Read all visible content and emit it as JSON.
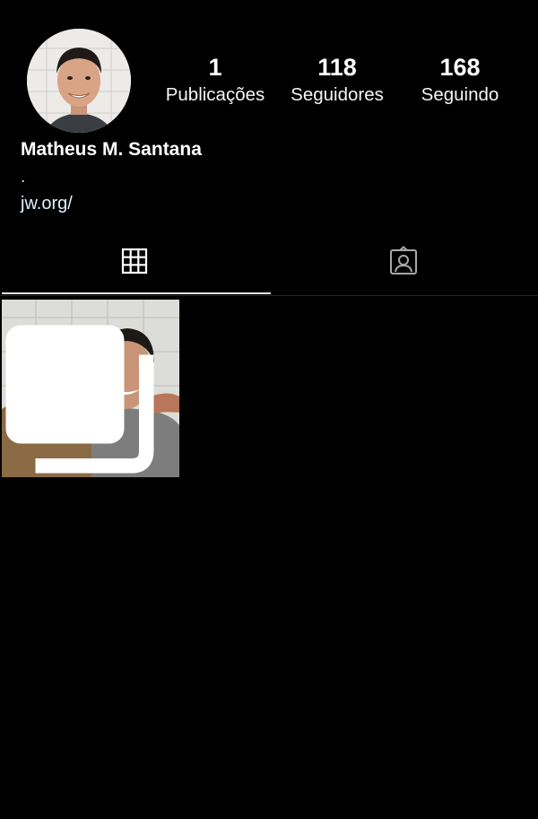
{
  "profile": {
    "name": "Matheus M. Santana",
    "bio": ".",
    "link": "jw.org/",
    "avatar_icon": "profile-photo"
  },
  "stats": {
    "posts": {
      "count": "1",
      "label": "Publicações"
    },
    "followers": {
      "count": "118",
      "label": "Seguidores"
    },
    "following": {
      "count": "168",
      "label": "Seguindo"
    }
  },
  "tabs": [
    {
      "name": "posts-grid",
      "icon": "grid-icon",
      "active": true
    },
    {
      "name": "tagged",
      "icon": "tagged-person-icon",
      "active": false
    }
  ],
  "posts": [
    {
      "icon": "multiple-images-icon"
    }
  ],
  "colors": {
    "background": "#000000",
    "text": "#ffffff",
    "divider": "#262626",
    "active_indicator": "#e6e6e6"
  }
}
